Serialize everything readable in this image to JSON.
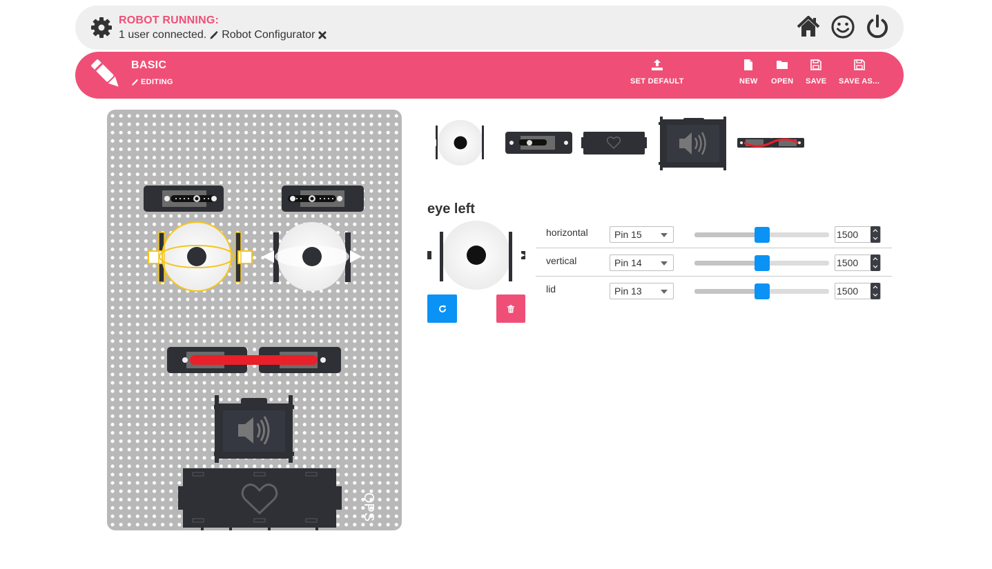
{
  "status": {
    "title": "ROBOT RUNNING:",
    "users_text": "1 user connected.",
    "app_text": "Robot Configurator",
    "icons": [
      "gear-icon",
      "pencil-icon",
      "close-icon",
      "home-icon",
      "smiley-icon",
      "power-icon"
    ]
  },
  "header": {
    "title": "BASIC",
    "editing_label": "EDITING",
    "actions": {
      "set_default": "SET DEFAULT",
      "new": "NEW",
      "open": "OPEN",
      "save": "SAVE",
      "save_as": "SAVE AS..."
    }
  },
  "colors": {
    "accent": "#ef4f77",
    "primary": "#0a92f5",
    "status_bg": "#efefef",
    "board": "#b8b8b8",
    "module": "#2e3035",
    "selected": "#f5c518",
    "mouth": "#e8202a"
  },
  "palette": {
    "items": [
      "eye-module",
      "servo-module",
      "heart-module",
      "speaker-module",
      "mouth-module"
    ]
  },
  "board": {
    "logo_text": "OPS"
  },
  "inspector": {
    "title": "eye left",
    "rows": [
      {
        "label": "horizontal",
        "pin": "Pin 15",
        "value": "1500",
        "level": 0.5
      },
      {
        "label": "vertical",
        "pin": "Pin 14",
        "value": "1500",
        "level": 0.5
      },
      {
        "label": "lid",
        "pin": "Pin 13",
        "value": "1500",
        "level": 0.5
      }
    ]
  }
}
